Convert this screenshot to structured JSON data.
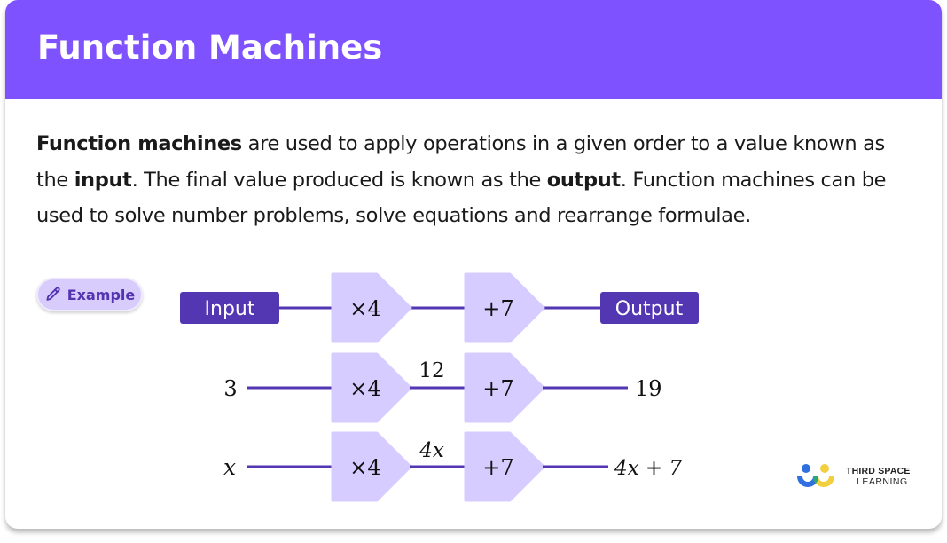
{
  "header": {
    "title": "Function Machines"
  },
  "intro": {
    "seg1_bold": "Function machines",
    "seg2": " are used to apply operations in a given order to a value known as the ",
    "seg3_bold": "input",
    "seg4": ". The final value produced is known as the ",
    "seg5_bold": "output",
    "seg6": ". Function machines can be used to solve number problems, solve equations and rearrange formulae."
  },
  "example_badge": {
    "label": "Example",
    "icon": "pencil-icon"
  },
  "diagram": {
    "colors": {
      "dark_box": "#5236b2",
      "machine_fill": "#d6ccff",
      "line": "#5236b2",
      "text": "#111111"
    },
    "header_row": {
      "input_label": "Input",
      "output_label": "Output"
    },
    "machines": [
      "×4",
      "+7"
    ],
    "rows": [
      {
        "input": "3",
        "intermediate": "12",
        "output": "19"
      },
      {
        "input": "x",
        "intermediate": "4x",
        "output": "4x + 7"
      }
    ]
  },
  "logo": {
    "line1": "THIRD SPACE",
    "line2": "LEARNING"
  }
}
